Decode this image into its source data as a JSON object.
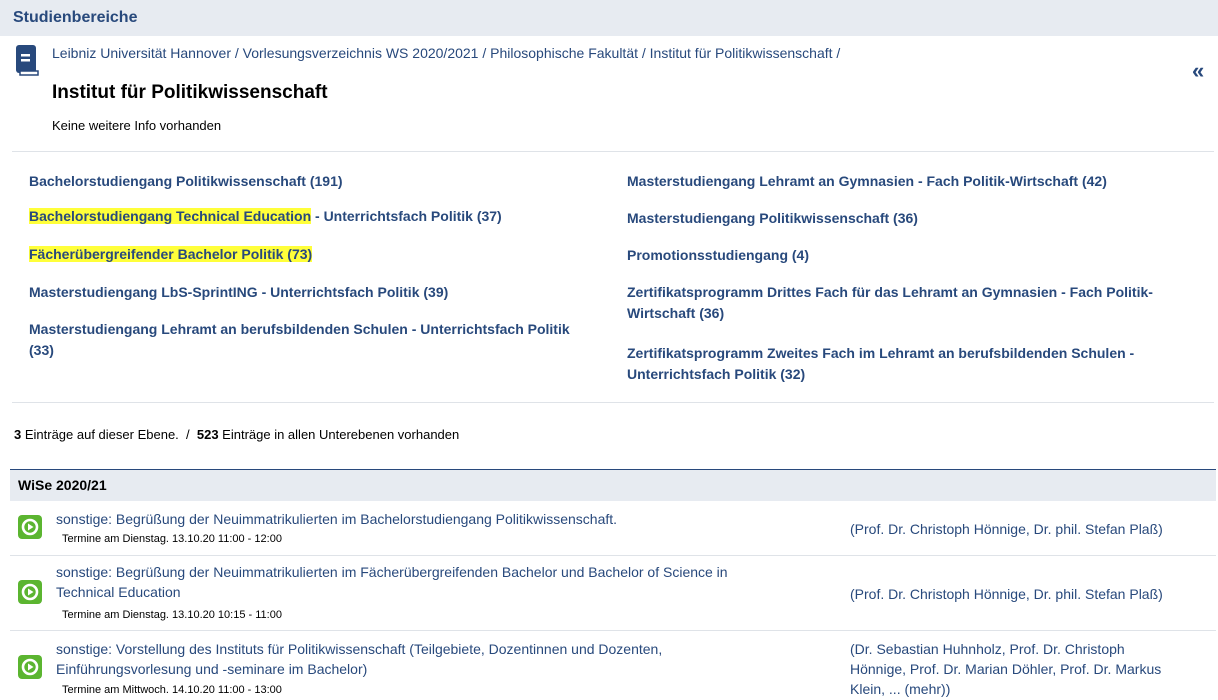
{
  "header": {
    "title": "Studienbereiche"
  },
  "breadcrumb": [
    "Leibniz Universität Hannover /",
    "Vorlesungsverzeichnis WS 2020/2021 /",
    "Philosophische Fakultät /",
    "Institut für Politikwissenschaft /"
  ],
  "page": {
    "title": "Institut für Politikwissenschaft",
    "info": "Keine weitere Info vorhanden"
  },
  "left_links": [
    {
      "text": "Bachelorstudiengang Politikwissenschaft (191)"
    },
    {
      "hl": "Bachelorstudiengang Technical Education",
      "rest": " - Unterrichtsfach Politik (37)"
    },
    {
      "hl": "Fächerübergreifender Bachelor Politik (73)"
    },
    {
      "text": "Masterstudiengang LbS-SprintING - Unterrichtsfach Politik (39)"
    },
    {
      "line1": "Masterstudiengang Lehramt an berufsbildenden Schulen - Unterrichtsfach Politik",
      "line2": "(33)"
    }
  ],
  "right_links": [
    {
      "text": "Masterstudiengang Lehramt an Gymnasien - Fach Politik-Wirtschaft (42)"
    },
    {
      "text": "Masterstudiengang Politikwissenschaft (36)"
    },
    {
      "text": "Promotionsstudiengang (4)"
    },
    {
      "line1": "Zertifikatsprogramm Drittes Fach für das Lehramt an Gymnasien - Fach Politik-",
      "line2": "Wirtschaft (36)"
    },
    {
      "line1": "Zertifikatsprogramm Zweites Fach im Lehramt an berufsbildenden Schulen -",
      "line2": "Unterrichtsfach Politik (32)"
    }
  ],
  "counts": {
    "level_count": "3",
    "level_text": " Einträge auf dieser Ebene.",
    "sep": "  /  ",
    "total_count": "523",
    "total_text": " Einträge in allen Unterebenen vorhanden"
  },
  "semester": {
    "label": "WiSe 2020/21"
  },
  "courses": [
    {
      "title1": "sonstige: Begrüßung der Neuimmatrikulierten im Bachelorstudiengang Politikwissenschaft.",
      "title2": "",
      "time": "Termine am Dienstag. 13.10.20 11:00 - 12:00",
      "lect1": "(Prof. Dr. Christoph Hönnige, Dr. phil. Stefan Plaß)",
      "lect2": "",
      "lect3": ""
    },
    {
      "title1": "sonstige: Begrüßung der Neuimmatrikulierten im Fächerübergreifenden Bachelor und Bachelor of Science in",
      "title2": "Technical Education",
      "time": "Termine am Dienstag. 13.10.20 10:15 - 11:00",
      "lect1": "(Prof. Dr. Christoph Hönnige, Dr. phil. Stefan Plaß)",
      "lect2": "",
      "lect3": ""
    },
    {
      "title1": "sonstige: Vorstellung des Instituts für Politikwissenschaft (Teilgebiete, Dozentinnen und Dozenten,",
      "title2": "Einführungsvorlesung und -seminare im Bachelor)",
      "time": "Termine am Mittwoch. 14.10.20 11:00 - 13:00",
      "lect1": "(Dr. Sebastian Huhnholz, Prof. Dr. Christoph",
      "lect2": "Hönnige, Prof. Dr. Marian Döhler, Prof. Dr. Markus",
      "lect3": "Klein, ... (mehr))"
    }
  ],
  "colors": {
    "link": "#28497c",
    "highlight": "#ffff3a",
    "header_bg": "#e7ebf1",
    "course_icon": "#5bb530"
  },
  "icons": {
    "book": "book-icon",
    "collapse": "double-chevron-left-icon",
    "course": "course-type-icon"
  }
}
